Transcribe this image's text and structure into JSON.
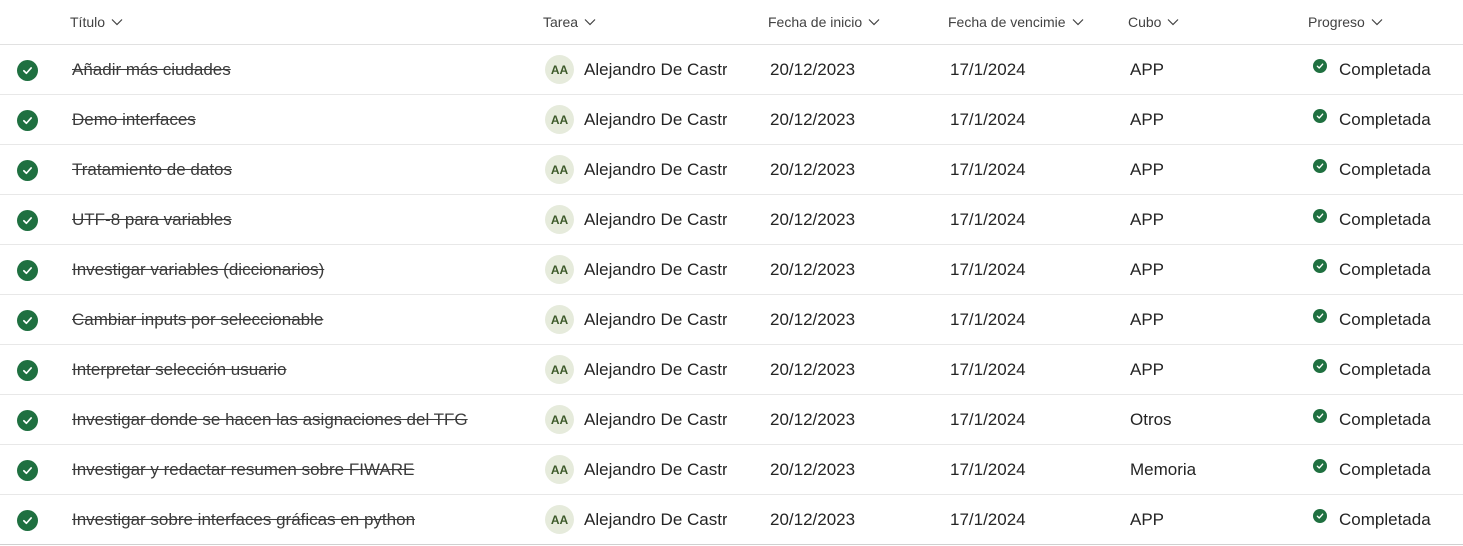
{
  "columns": {
    "title": "Título",
    "task": "Tarea",
    "start": "Fecha de inicio",
    "due": "Fecha de vencimie",
    "bucket": "Cubo",
    "progress": "Progreso"
  },
  "colors": {
    "complete": "#1f7040",
    "avatar_bg": "#e6ebdc"
  },
  "rows": [
    {
      "title": "Añadir más ciudades",
      "initials": "AA",
      "assignee": "Alejandro De Castro",
      "start": "20/12/2023",
      "due": "17/1/2024",
      "bucket": "APP",
      "progress": "Completada"
    },
    {
      "title": "Demo interfaces",
      "initials": "AA",
      "assignee": "Alejandro De Castro",
      "start": "20/12/2023",
      "due": "17/1/2024",
      "bucket": "APP",
      "progress": "Completada"
    },
    {
      "title": "Tratamiento de datos",
      "initials": "AA",
      "assignee": "Alejandro De Castro",
      "start": "20/12/2023",
      "due": "17/1/2024",
      "bucket": "APP",
      "progress": "Completada"
    },
    {
      "title": "UTF-8 para variables",
      "initials": "AA",
      "assignee": "Alejandro De Castro",
      "start": "20/12/2023",
      "due": "17/1/2024",
      "bucket": "APP",
      "progress": "Completada"
    },
    {
      "title": "Investigar variables (diccionarios)",
      "initials": "AA",
      "assignee": "Alejandro De Castro",
      "start": "20/12/2023",
      "due": "17/1/2024",
      "bucket": "APP",
      "progress": "Completada"
    },
    {
      "title": "Cambiar inputs por seleccionable",
      "initials": "AA",
      "assignee": "Alejandro De Castro",
      "start": "20/12/2023",
      "due": "17/1/2024",
      "bucket": "APP",
      "progress": "Completada"
    },
    {
      "title": "Interpretar selección usuario",
      "initials": "AA",
      "assignee": "Alejandro De Castro",
      "start": "20/12/2023",
      "due": "17/1/2024",
      "bucket": "APP",
      "progress": "Completada"
    },
    {
      "title": "Investigar donde se hacen las asignaciones del TFG",
      "initials": "AA",
      "assignee": "Alejandro De Castro",
      "start": "20/12/2023",
      "due": "17/1/2024",
      "bucket": "Otros",
      "progress": "Completada"
    },
    {
      "title": "Investigar y redactar resumen sobre FIWARE",
      "initials": "AA",
      "assignee": "Alejandro De Castro",
      "start": "20/12/2023",
      "due": "17/1/2024",
      "bucket": "Memoria",
      "progress": "Completada"
    },
    {
      "title": "Investigar sobre interfaces gráficas en python",
      "initials": "AA",
      "assignee": "Alejandro De Castro",
      "start": "20/12/2023",
      "due": "17/1/2024",
      "bucket": "APP",
      "progress": "Completada"
    }
  ]
}
